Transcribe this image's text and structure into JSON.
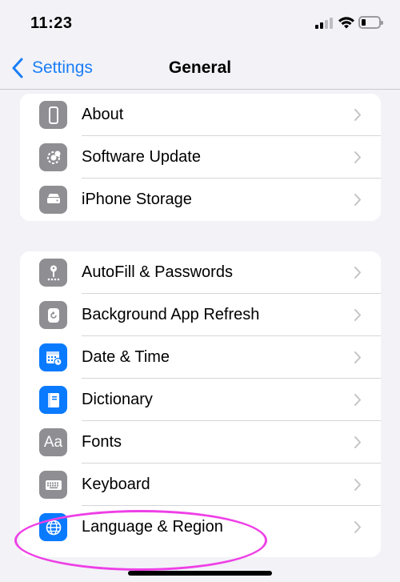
{
  "status_bar": {
    "time": "11:23"
  },
  "nav": {
    "back_label": "Settings",
    "title": "General"
  },
  "groups": [
    {
      "rows": [
        {
          "label": "About",
          "icon": "phone-icon",
          "icon_color": "#8e8e93"
        },
        {
          "label": "Software Update",
          "icon": "gear-icon",
          "icon_color": "#8e8e93"
        },
        {
          "label": "iPhone Storage",
          "icon": "storage-icon",
          "icon_color": "#8e8e93"
        }
      ]
    },
    {
      "rows": [
        {
          "label": "AutoFill & Passwords",
          "icon": "key-icon",
          "icon_color": "#8e8e93"
        },
        {
          "label": "Background App Refresh",
          "icon": "refresh-icon",
          "icon_color": "#8e8e93"
        },
        {
          "label": "Date & Time",
          "icon": "calendar-clock-icon",
          "icon_color": "#0a7aff"
        },
        {
          "label": "Dictionary",
          "icon": "book-icon",
          "icon_color": "#0a7aff"
        },
        {
          "label": "Fonts",
          "icon": "fonts-icon",
          "icon_color": "#8e8e93",
          "icon_text": "Aa"
        },
        {
          "label": "Keyboard",
          "icon": "keyboard-icon",
          "icon_color": "#8e8e93"
        },
        {
          "label": "Language & Region",
          "icon": "globe-icon",
          "icon_color": "#0a7aff"
        }
      ]
    }
  ],
  "colors": {
    "accent": "#1a7ef6",
    "highlight": "#ee3fe6"
  }
}
